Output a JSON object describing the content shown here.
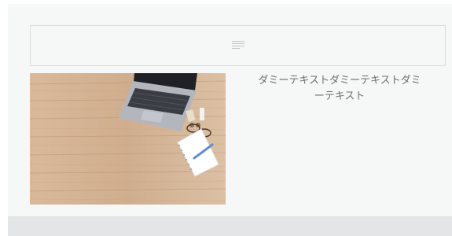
{
  "editor": {
    "placeholder_icon": "paragraph-lines-icon"
  },
  "media_text": {
    "image_alt": "laptop and notebook on wooden desk",
    "text": "ダミーテキストダミーテキストダミーテキスト"
  },
  "colors": {
    "canvas_bg": "#f6f7f7",
    "block_border": "#dcdcde",
    "footer_bg": "#e4e5e6",
    "text": "#6b6f73"
  }
}
